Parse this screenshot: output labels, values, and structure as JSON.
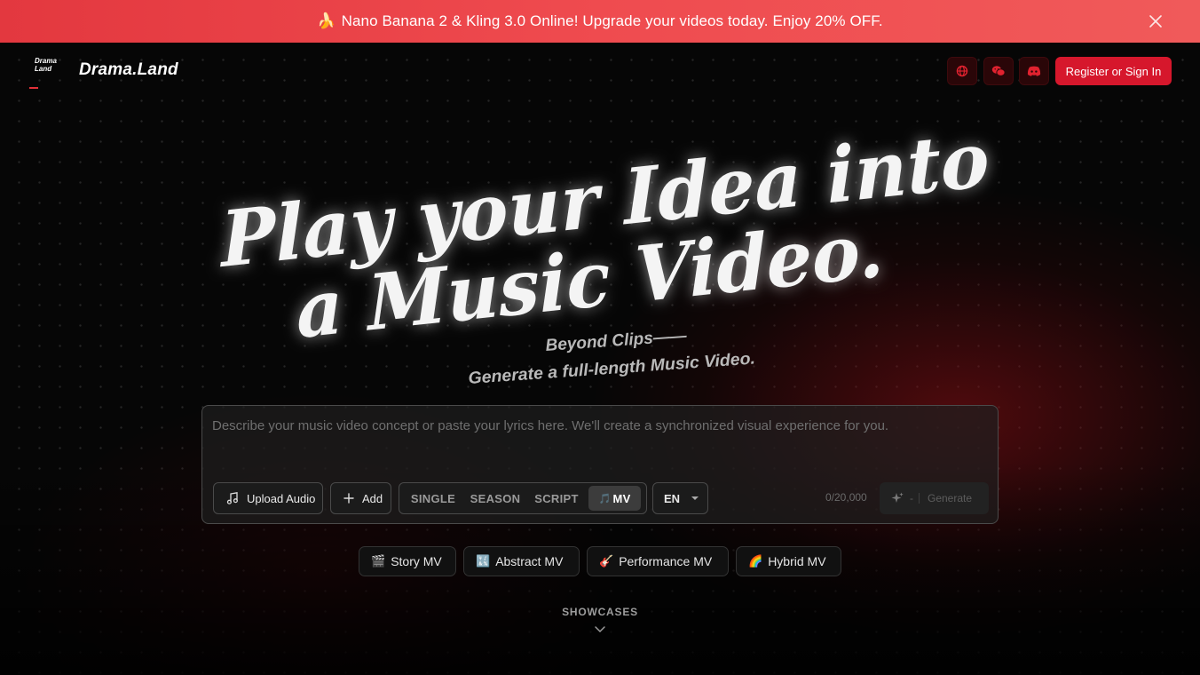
{
  "promo": {
    "emoji": "🍌",
    "text": "Nano Banana 2 & Kling 3.0 Online! Upgrade your videos today. Enjoy 20% OFF.",
    "close_icon": "close-icon",
    "bg_color": "#e3383f"
  },
  "header": {
    "logo_mark_line1": "Drama",
    "logo_mark_line2": "Land",
    "logo_text": "Drama.Land",
    "icons": [
      "globe-icon",
      "wechat-icon",
      "discord-icon"
    ],
    "signin_label": "Register or Sign In",
    "accent_color": "#d6172c"
  },
  "hero": {
    "title_line1": "Play your Idea into",
    "title_line2": "a Music Video.",
    "subtitle_line1": "Beyond Clips——",
    "subtitle_line2": "Generate a full-length Music Video."
  },
  "prompt": {
    "placeholder": "Describe your music video concept or paste your lyrics here. We'll create a synchronized visual experience for you.",
    "upload_label": "Upload Audio",
    "add_label": "Add",
    "modes": [
      "SINGLE",
      "SEASON",
      "SCRIPT",
      "MV"
    ],
    "active_mode": "MV",
    "language": "EN",
    "char_count": "0/20,000",
    "generate_cost": "-",
    "generate_label": "Generate"
  },
  "styles": [
    {
      "emoji": "🎬",
      "label": "Story MV"
    },
    {
      "emoji": "🔣",
      "label": "Abstract MV"
    },
    {
      "emoji": "🎸",
      "label": "Performance MV"
    },
    {
      "emoji": "🌈",
      "label": "Hybrid MV"
    }
  ],
  "showcase": {
    "label": "SHOWCASES",
    "icon": "chevron-down-icon"
  }
}
